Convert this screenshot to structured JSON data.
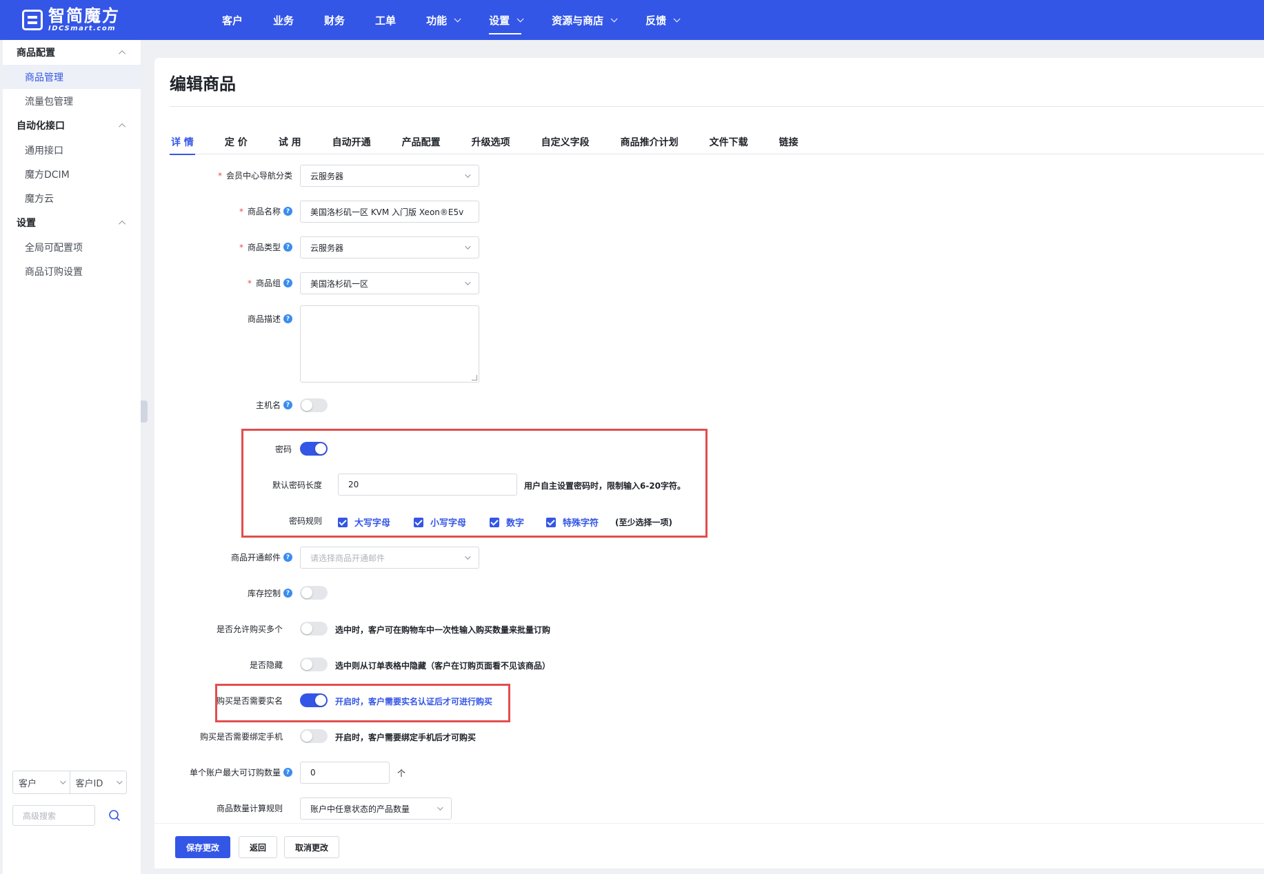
{
  "brand": {
    "name_cn": "智简魔方",
    "name_en": "IDCSmart.com"
  },
  "nav": [
    {
      "label": "客户",
      "dropdown": false
    },
    {
      "label": "业务",
      "dropdown": false
    },
    {
      "label": "财务",
      "dropdown": false
    },
    {
      "label": "工单",
      "dropdown": false
    },
    {
      "label": "功能",
      "dropdown": true
    },
    {
      "label": "设置",
      "dropdown": true,
      "active": true
    },
    {
      "label": "资源与商店",
      "dropdown": true
    },
    {
      "label": "反馈",
      "dropdown": true
    }
  ],
  "sidebar": {
    "groups": [
      {
        "title": "商品配置",
        "items": [
          "商品管理",
          "流量包管理"
        ]
      },
      {
        "title": "自动化接口",
        "items": [
          "通用接口",
          "魔方DCIM",
          "魔方云"
        ]
      },
      {
        "title": "设置",
        "items": [
          "全局可配置项",
          "商品订购设置"
        ]
      }
    ],
    "active_item": "商品管理",
    "filter_type": "客户",
    "filter_field": "客户ID",
    "search_placeholder": "高级搜索"
  },
  "page": {
    "title": "编辑商品"
  },
  "tabs": [
    "详 情",
    "定 价",
    "试 用",
    "自动开通",
    "产品配置",
    "升级选项",
    "自定义字段",
    "商品推介计划",
    "文件下载",
    "链接"
  ],
  "form": {
    "nav_category": {
      "label": "会员中心导航分类",
      "value": "云服务器"
    },
    "product_name": {
      "label": "商品名称",
      "value": "美国洛杉矶一区 KVM 入门版 Xeon®E5v"
    },
    "product_type": {
      "label": "商品类型",
      "value": "云服务器"
    },
    "product_group": {
      "label": "商品组",
      "value": "美国洛杉矶一区"
    },
    "description": {
      "label": "商品描述",
      "value": ""
    },
    "hostname": {
      "label": "主机名",
      "on": false
    },
    "password": {
      "label": "密码",
      "on": true
    },
    "password_length": {
      "label": "默认密码长度",
      "value": "20",
      "hint": "用户自主设置密码时，限制输入6-20字符。"
    },
    "password_rules": {
      "label": "密码规则",
      "options": [
        "大写字母",
        "小写字母",
        "数字",
        "特殊字符"
      ],
      "hint": "(至少选择一项)"
    },
    "open_email": {
      "label": "商品开通邮件",
      "placeholder": "请选择商品开通邮件"
    },
    "stock_control": {
      "label": "库存控制",
      "on": false
    },
    "allow_multiple": {
      "label": "是否允许购买多个",
      "on": false,
      "hint": "选中时，客户可在购物车中一次性输入购买数量来批量订购"
    },
    "hidden": {
      "label": "是否隐藏",
      "on": false,
      "hint": "选中则从订单表格中隐藏（客户在订购页面看不见该商品）"
    },
    "require_realname": {
      "label": "购买是否需要实名",
      "on": true,
      "hint": "开启时，客户需要实名认证后才可进行购买"
    },
    "require_phone": {
      "label": "购买是否需要绑定手机",
      "on": false,
      "hint": "开启时，客户需要绑定手机后才可购买"
    },
    "max_per_account": {
      "label": "单个账户最大可订购数量",
      "value": "0",
      "unit": "个"
    },
    "count_rule": {
      "label": "商品数量计算规则",
      "value": "账户中任意状态的产品数量"
    }
  },
  "actions": {
    "save": "保存更改",
    "back": "返回",
    "cancel": "取消更改"
  },
  "colors": {
    "primary": "#3456e6",
    "highlight_frame": "#e34d4d",
    "required": "#e34d4d"
  }
}
